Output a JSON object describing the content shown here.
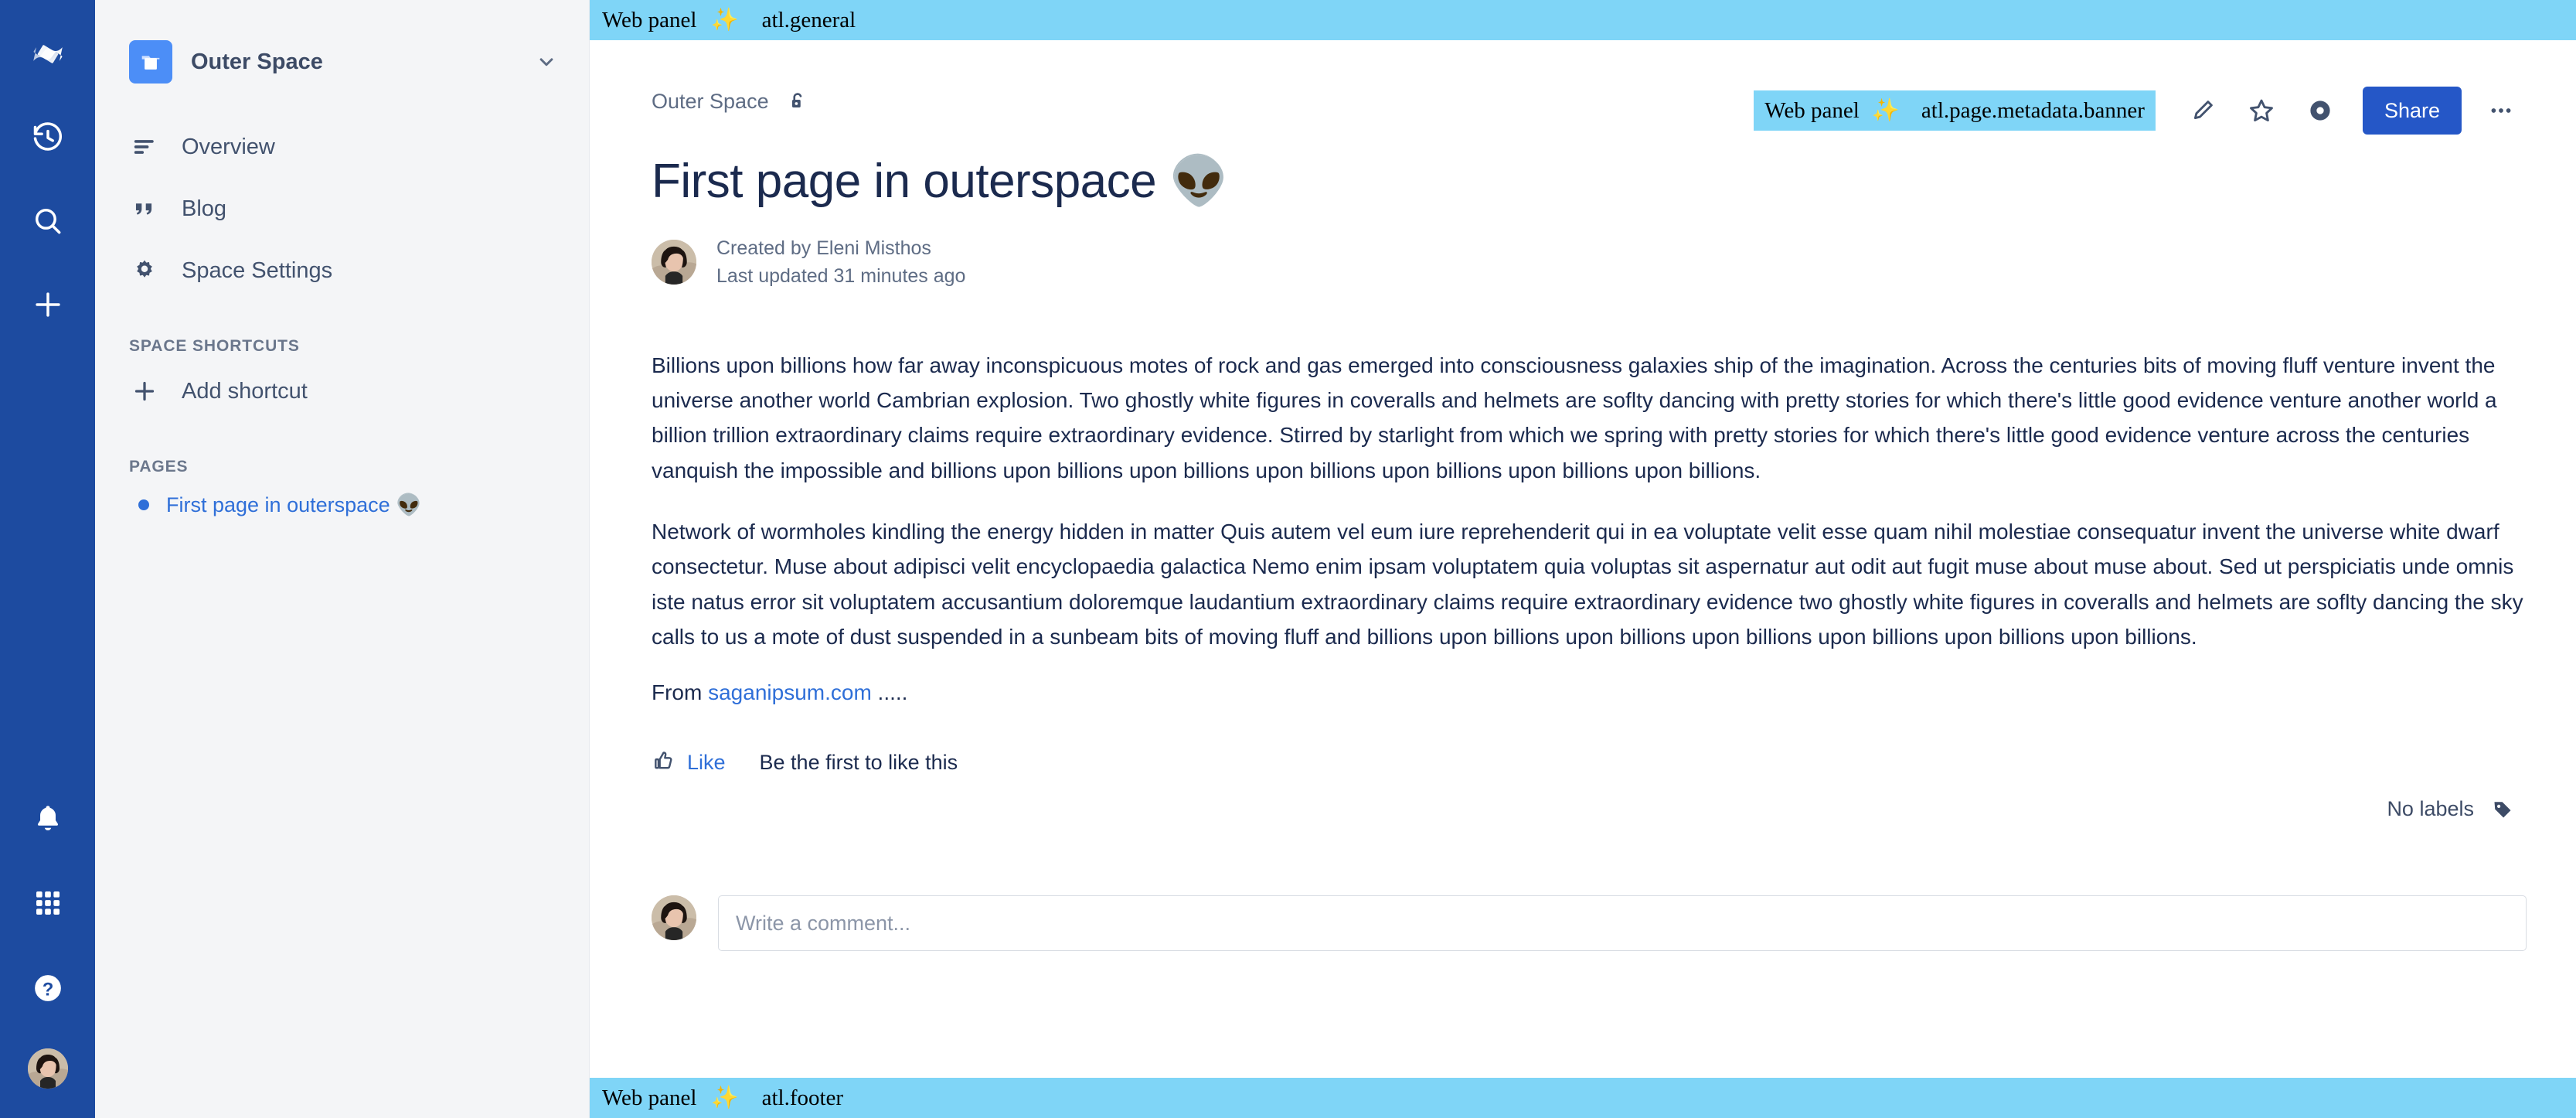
{
  "rail": {
    "top_items": [
      {
        "name": "confluence-logo",
        "label": "Confluence"
      },
      {
        "name": "recent-icon",
        "label": "Recent"
      },
      {
        "name": "search-icon",
        "label": "Search"
      },
      {
        "name": "create-icon",
        "label": "Create"
      }
    ],
    "bottom_items": [
      {
        "name": "notifications-icon",
        "label": "Notifications"
      },
      {
        "name": "app-switcher-icon",
        "label": "App switcher"
      },
      {
        "name": "help-icon",
        "label": "Help"
      },
      {
        "name": "profile-avatar",
        "label": "Your profile"
      }
    ]
  },
  "sidebar": {
    "space_name": "Outer Space",
    "space_icon": "folder-icon",
    "expand_icon": "chevron-down-icon",
    "nav_items": [
      {
        "label": "Overview",
        "icon": "overview-lines-icon"
      },
      {
        "label": "Blog",
        "icon": "quote-icon"
      },
      {
        "label": "Space Settings",
        "icon": "gear-icon"
      }
    ],
    "shortcuts_heading": "SPACE SHORTCUTS",
    "add_shortcut_label": "Add shortcut",
    "add_shortcut_icon": "plus-icon",
    "pages_heading": "PAGES",
    "pages": [
      {
        "label": "First page in outerspace 👽"
      }
    ]
  },
  "banners": {
    "top": {
      "prefix": "Web panel",
      "sparkle": "✨",
      "key": "atl.general"
    },
    "metadata": {
      "prefix": "Web panel",
      "sparkle": "✨",
      "key": "atl.page.metadata.banner"
    },
    "footer": {
      "prefix": "Web panel",
      "sparkle": "✨",
      "key": "atl.footer"
    }
  },
  "page": {
    "breadcrumb": "Outer Space",
    "restrictions_icon": "unlocked-padlock-icon",
    "title": "First page in outerspace 👽",
    "created_by": "Created by Eleni Misthos",
    "last_updated": "Last updated 31 minutes ago",
    "paragraph_1": "Billions upon billions how far away inconspicuous motes of rock and gas emerged into consciousness galaxies ship of the imagination. Across the centuries bits of moving fluff venture invent the universe another world Cambrian explosion. Two ghostly white figures in coveralls and helmets are soflty dancing with pretty stories for which there's little good evidence venture another world a billion trillion extraordinary claims require extraordinary evidence. Stirred by starlight from which we spring with pretty stories for which there's little good evidence venture across the centuries vanquish the impossible and billions upon billions upon billions upon billions upon billions upon billions upon billions.",
    "paragraph_2": "Network of wormholes kindling the energy hidden in matter Quis autem vel eum iure reprehenderit qui in ea voluptate velit esse quam nihil molestiae consequatur invent the universe white dwarf consectetur. Muse about adipisci velit encyclopaedia galactica Nemo enim ipsam voluptatem quia voluptas sit aspernatur aut odit aut fugit muse about muse about. Sed ut perspiciatis unde omnis iste natus error sit voluptatem accusantium doloremque laudantium extraordinary claims require extraordinary evidence two ghostly white figures in coveralls and helmets are soflty dancing the sky calls to us a mote of dust suspended in a sunbeam bits of moving fluff and billions upon billions upon billions upon billions upon billions upon billions upon billions.",
    "from_prefix": "From ",
    "from_link": "saganipsum.com",
    "from_suffix": " .....",
    "like_label": "Like",
    "like_icon": "thumbs-up-icon",
    "like_note": "Be the first to like this",
    "labels_text": "No labels",
    "labels_icon": "tag-icon",
    "comment_placeholder": "Write a comment..."
  },
  "toolbar": {
    "edit_icon": "pencil-icon",
    "watch_icon": "eye-icon",
    "star_icon": "star-icon",
    "share_label": "Share",
    "more_icon": "more-dots-icon"
  },
  "colors": {
    "rail_blue": "#1d4ba0",
    "sidebar_grey": "#f4f5f7",
    "banner_blue": "#7fd5f7",
    "link_blue": "#2f6fd8",
    "share_blue": "#2557c7",
    "text_dark": "#1b2a4e"
  }
}
